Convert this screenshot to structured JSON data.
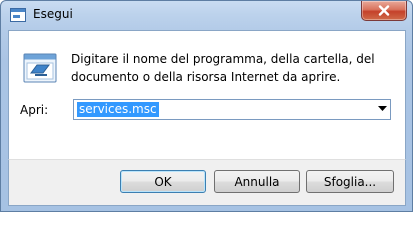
{
  "window": {
    "title": "Esegui",
    "icon": "run-window-icon",
    "close_icon": "close-icon"
  },
  "dialog": {
    "icon": "run-program-icon",
    "description": "Digitare il nome del programma, della cartella, del documento o della risorsa Internet da aprire.",
    "open_label": "Apri:",
    "open_value": "services.msc",
    "dropdown_icon": "chevron-down-icon"
  },
  "buttons": {
    "ok": "OK",
    "cancel": "Annulla",
    "browse": "Sfoglia..."
  },
  "colors": {
    "selection": "#3399ff",
    "close_button": "#c4412a",
    "frame": "#b3cbe8"
  }
}
